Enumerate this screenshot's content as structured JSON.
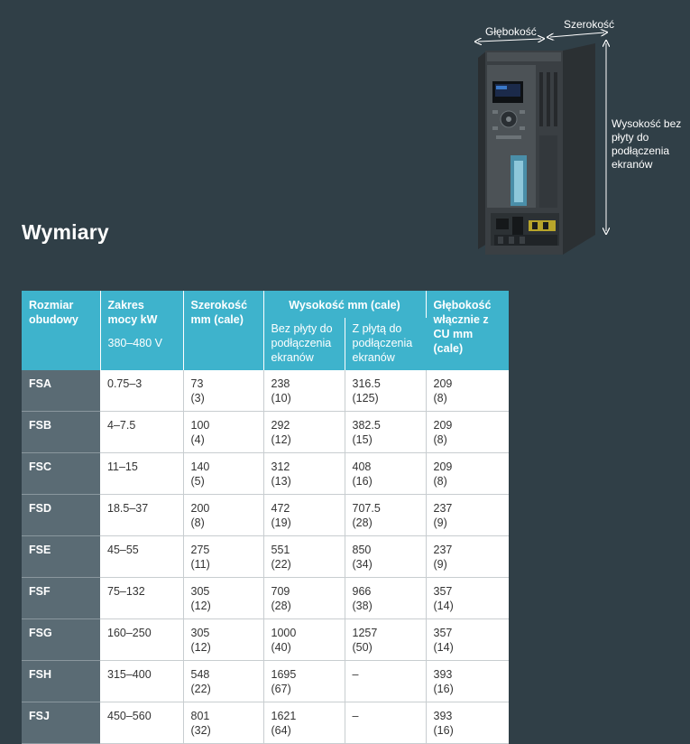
{
  "title": "Wymiary",
  "device": {
    "depth_label": "Głębokość",
    "width_label": "Szerokość",
    "height_label": "Wysokość bez płyty do podłączenia ekranów"
  },
  "table": {
    "headers": {
      "frame": "Rozmiar obudowy",
      "power": "Zakres mocy kW",
      "power_voltage": "380–480 V",
      "width": "Szerokość mm (cale)",
      "height_group": "Wysokość mm (cale)",
      "height_without": "Bez płyty do podłączenia ekranów",
      "height_with": "Z płytą do podłączenia ekranów",
      "depth": "Głębokość włącznie z CU mm (cale)"
    },
    "rows": [
      {
        "frame": "FSA",
        "power": "0.75–3",
        "width_mm": "73",
        "width_in": "(3)",
        "h1_mm": "238",
        "h1_in": "(10)",
        "h2_mm": "316.5",
        "h2_in": "(125)",
        "d_mm": "209",
        "d_in": "(8)"
      },
      {
        "frame": "FSB",
        "power": "4–7.5",
        "width_mm": "100",
        "width_in": "(4)",
        "h1_mm": "292",
        "h1_in": "(12)",
        "h2_mm": "382.5",
        "h2_in": "(15)",
        "d_mm": "209",
        "d_in": "(8)"
      },
      {
        "frame": "FSC",
        "power": "11–15",
        "width_mm": "140",
        "width_in": "(5)",
        "h1_mm": "312",
        "h1_in": "(13)",
        "h2_mm": "408",
        "h2_in": "(16)",
        "d_mm": "209",
        "d_in": "(8)"
      },
      {
        "frame": "FSD",
        "power": "18.5–37",
        "width_mm": "200",
        "width_in": "(8)",
        "h1_mm": "472",
        "h1_in": "(19)",
        "h2_mm": "707.5",
        "h2_in": "(28)",
        "d_mm": "237",
        "d_in": "(9)"
      },
      {
        "frame": "FSE",
        "power": "45–55",
        "width_mm": "275",
        "width_in": "(11)",
        "h1_mm": "551",
        "h1_in": "(22)",
        "h2_mm": "850",
        "h2_in": "(34)",
        "d_mm": "237",
        "d_in": "(9)"
      },
      {
        "frame": "FSF",
        "power": "75–132",
        "width_mm": "305",
        "width_in": "(12)",
        "h1_mm": "709",
        "h1_in": "(28)",
        "h2_mm": "966",
        "h2_in": "(38)",
        "d_mm": "357",
        "d_in": "(14)"
      },
      {
        "frame": "FSG",
        "power": "160–250",
        "width_mm": "305",
        "width_in": "(12)",
        "h1_mm": "1000",
        "h1_in": "(40)",
        "h2_mm": "1257",
        "h2_in": "(50)",
        "d_mm": "357",
        "d_in": "(14)"
      },
      {
        "frame": "FSH",
        "power": "315–400",
        "width_mm": "548",
        "width_in": "(22)",
        "h1_mm": "1695",
        "h1_in": "(67)",
        "h2_mm": "–",
        "h2_in": "",
        "d_mm": "393",
        "d_in": "(16)"
      },
      {
        "frame": "FSJ",
        "power": "450–560",
        "width_mm": "801",
        "width_in": "(32)",
        "h1_mm": "1621",
        "h1_in": "(64)",
        "h2_mm": "–",
        "h2_in": "",
        "d_mm": "393",
        "d_in": "(16)"
      }
    ]
  }
}
